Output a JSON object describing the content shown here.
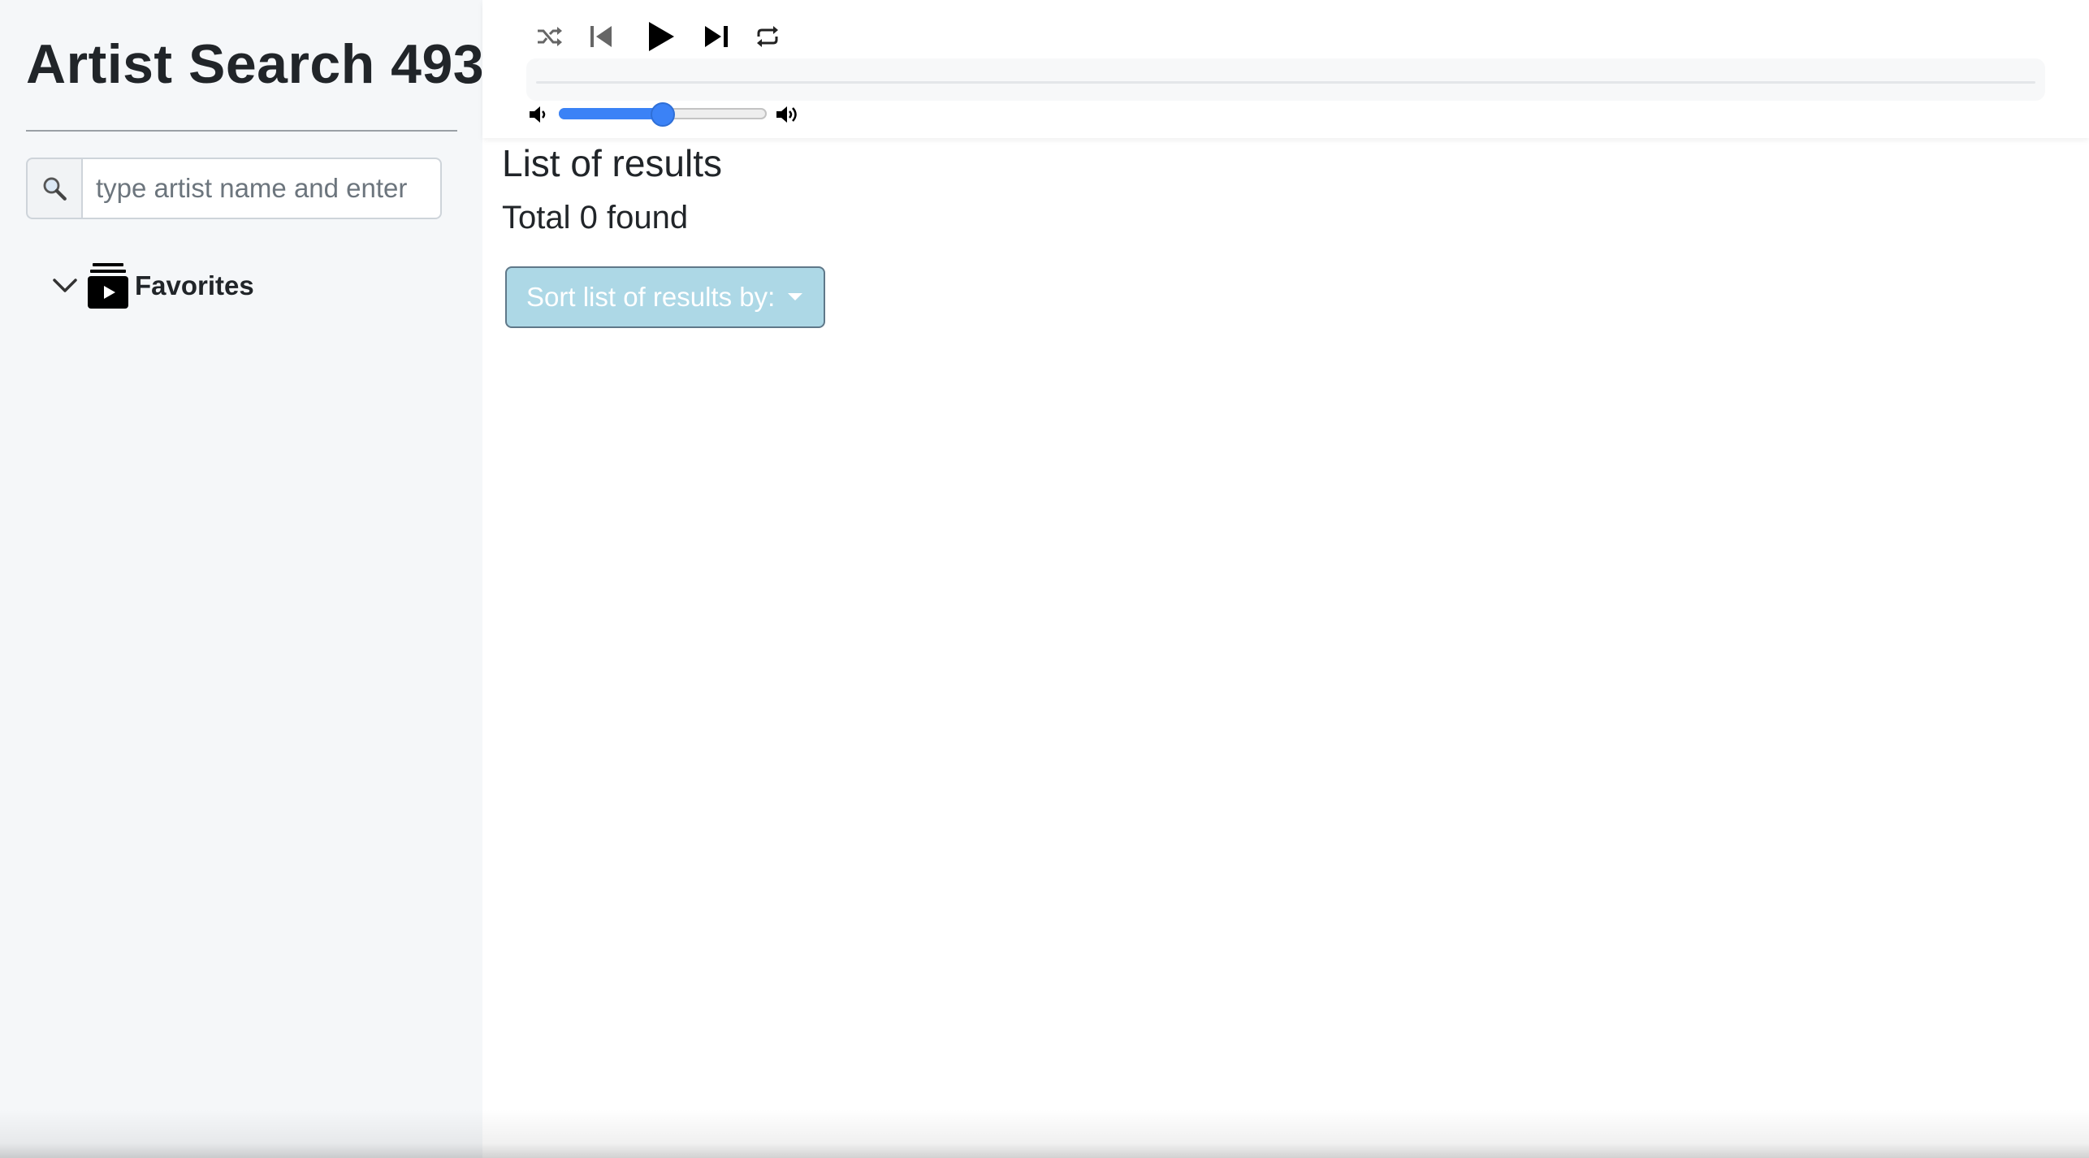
{
  "sidebar": {
    "app_title": "Artist Search 493",
    "search": {
      "icon": "magnifier-icon",
      "placeholder": "type artist name and enter",
      "value": ""
    },
    "favorites": {
      "label": "Favorites",
      "expanded": true,
      "icon": "playlist-icon"
    }
  },
  "player": {
    "controls": [
      "shuffle",
      "previous",
      "play",
      "next",
      "repeat"
    ],
    "volume_fraction": 0.5
  },
  "main": {
    "results_title": "List of results",
    "results_count": "Total 0 found",
    "sort_button_label": "Sort list of results by:"
  },
  "colors": {
    "sidebar_bg": "#f5f7f9",
    "accent": "#3b82f6",
    "sort_button_bg": "#add8e6"
  }
}
